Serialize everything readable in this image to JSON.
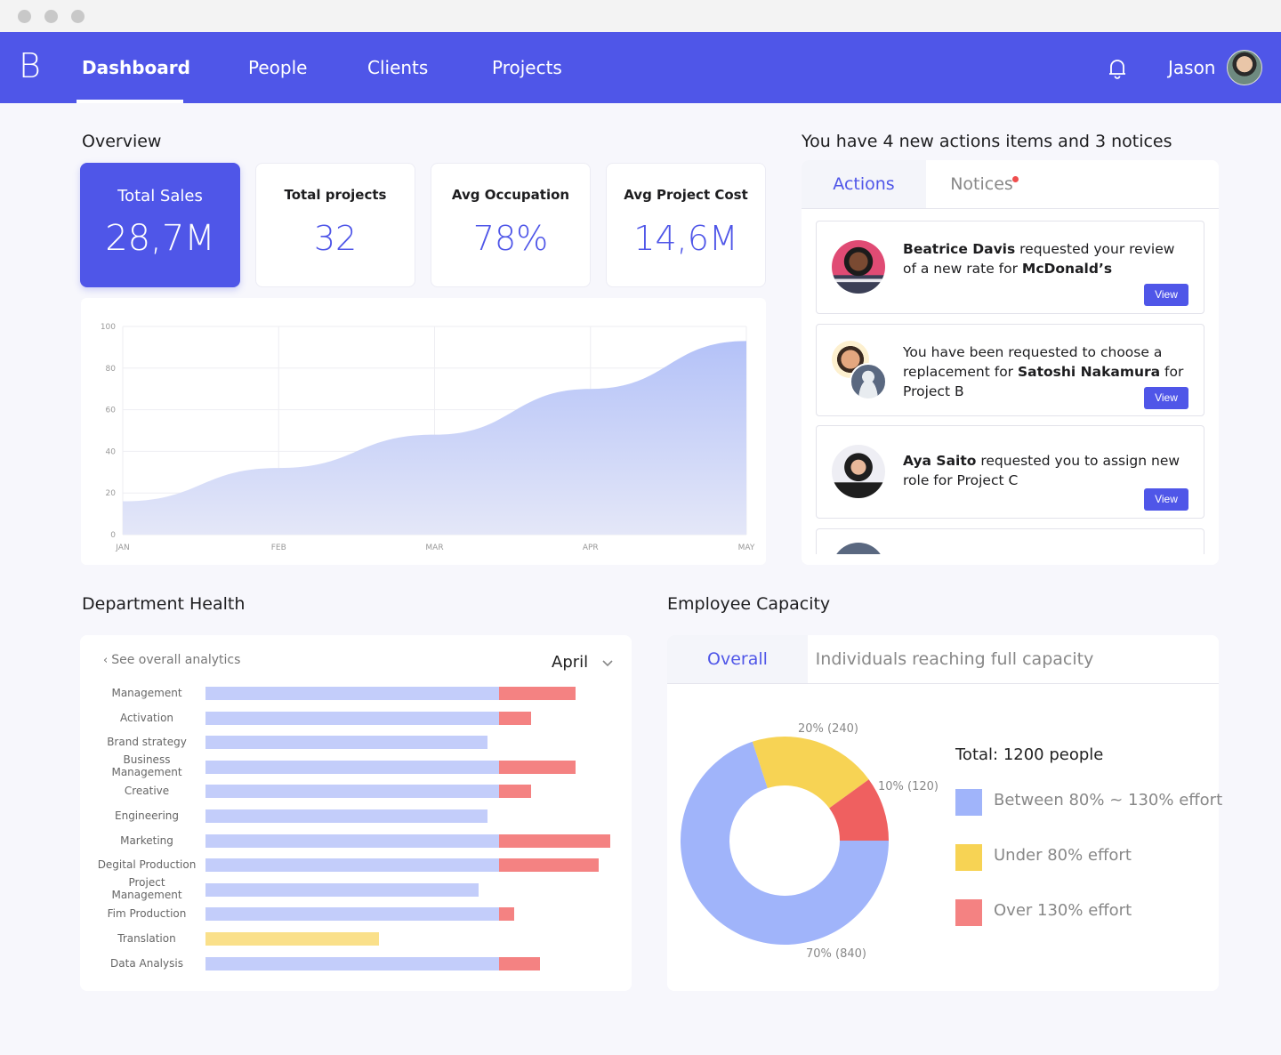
{
  "window": {
    "controls": [
      "close",
      "minimize",
      "maximize"
    ]
  },
  "nav": {
    "logo": "B",
    "items": [
      {
        "label": "Dashboard",
        "active": true
      },
      {
        "label": "People",
        "active": false
      },
      {
        "label": "Clients",
        "active": false
      },
      {
        "label": "Projects",
        "active": false
      }
    ],
    "bell_icon": "bell-icon",
    "user_name": "Jason"
  },
  "overview": {
    "title": "Overview",
    "stats": [
      {
        "label": "Total Sales",
        "value": "28,7M"
      },
      {
        "label": "Total projects",
        "value": "32"
      },
      {
        "label": "Avg Occupation",
        "value": "78%"
      },
      {
        "label": "Avg Project Cost",
        "value": "14,6M"
      }
    ]
  },
  "actions_panel": {
    "title": "You have 4 new actions items and 3 notices",
    "tabs": [
      {
        "label": "Actions",
        "active": true
      },
      {
        "label": "Notices",
        "active": false,
        "has_badge": true
      }
    ],
    "items": [
      {
        "pre": "",
        "bold1": "Beatrice Davis",
        "mid": " requested your review of a new rate for ",
        "bold2": "McDonald’s",
        "post": "",
        "button": "View"
      },
      {
        "pre": "You have been requested to choose a replacement for ",
        "bold1": "Satoshi Nakamura",
        "mid": " for Project B",
        "bold2": "",
        "post": "",
        "button": "View"
      },
      {
        "pre": "",
        "bold1": "Aya Saito",
        "mid": " requested you to assign new role for Project C",
        "bold2": "",
        "post": "",
        "button": "View"
      }
    ]
  },
  "department_health": {
    "title": "Department Health",
    "back_link": "See overall analytics",
    "month_select": "April"
  },
  "employee_capacity": {
    "title": "Employee Capacity",
    "tabs": [
      {
        "label": "Overall",
        "active": true
      },
      {
        "label": "Individuals reaching full capacity",
        "active": false
      }
    ],
    "total_label": "Total: 1200 people"
  },
  "colors": {
    "accent": "#4f56e8",
    "blue": "#a0b4fa",
    "bar_blue": "#c3cdfa",
    "yellow": "#f7d354",
    "bar_yellow": "#fae08a",
    "red": "#ef6060",
    "bar_red": "#f48282"
  },
  "chart_data": [
    {
      "type": "area",
      "title": "",
      "x": [
        "JAN",
        "FEB",
        "MAR",
        "APR",
        "MAY"
      ],
      "values": [
        16,
        32,
        48,
        70,
        93
      ],
      "ylim": [
        0,
        100
      ],
      "yticks": [
        0,
        20,
        40,
        60,
        80,
        100
      ],
      "grid": true,
      "xlabel": "",
      "ylabel": ""
    },
    {
      "type": "bar",
      "orientation": "horizontal",
      "title": "Department Health",
      "reference_full": 100,
      "categories": [
        "Management",
        "Activation",
        "Brand strategy",
        "Business Management",
        "Creative",
        "Engineering",
        "Marketing",
        "Degital Production",
        "Project Management",
        "Fim Production",
        "Translation",
        "Data Analysis"
      ],
      "values": [
        126,
        111,
        96,
        126,
        111,
        96,
        138,
        134,
        93,
        105,
        59,
        114
      ],
      "status": [
        "over",
        "over",
        "normal",
        "over",
        "over",
        "normal",
        "over",
        "over",
        "normal",
        "over",
        "under",
        "over"
      ],
      "unit": "% capacity"
    },
    {
      "type": "pie",
      "donut": true,
      "title": "Employee Capacity",
      "total": 1200,
      "slices": [
        {
          "name": "Between 80% ~ 130% effort",
          "value": 840,
          "percent": 70,
          "label": "70% (840)",
          "color": "#a0b4fa"
        },
        {
          "name": "Under 80% effort",
          "value": 240,
          "percent": 20,
          "label": "20% (240)",
          "color": "#f7d354"
        },
        {
          "name": "Over 130% effort",
          "value": 120,
          "percent": 10,
          "label": "10% (120)",
          "color": "#ef6060"
        }
      ],
      "legend": "right"
    }
  ]
}
